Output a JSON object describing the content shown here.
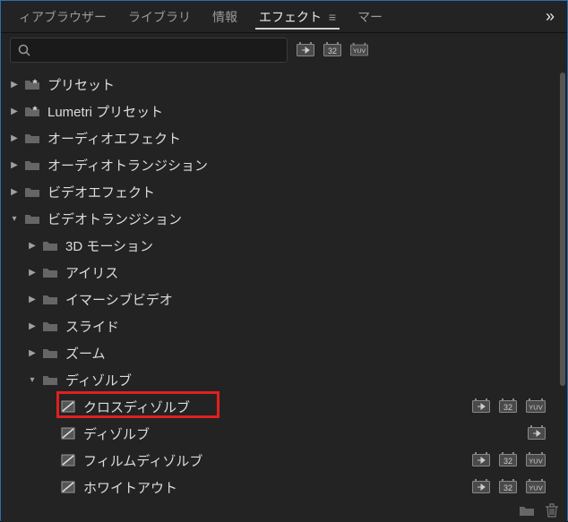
{
  "tabs": {
    "t0": "ィアブラウザー",
    "t1": "ライブラリ",
    "t2": "情報",
    "t3": "エフェクト",
    "t4": "マー"
  },
  "search": {
    "placeholder": ""
  },
  "badges": {
    "accel": "⬚▸",
    "px32": "32",
    "yuv": "YUV"
  },
  "tree": {
    "presets": "プリセット",
    "lumetri": "Lumetri プリセット",
    "audiofx": "オーディオエフェクト",
    "audiotr": "オーディオトランジション",
    "videofx": "ビデオエフェクト",
    "videotr": "ビデオトランジション",
    "motion3d": "3D モーション",
    "iris": "アイリス",
    "immersive": "イマーシブビデオ",
    "slide": "スライド",
    "zoom": "ズーム",
    "dissolve": "ディゾルブ",
    "crossdissolve": "クロスディゾルブ",
    "dissolve2": "ディゾルブ",
    "filmdissolve": "フィルムディゾルブ",
    "whiteout": "ホワイトアウト"
  }
}
